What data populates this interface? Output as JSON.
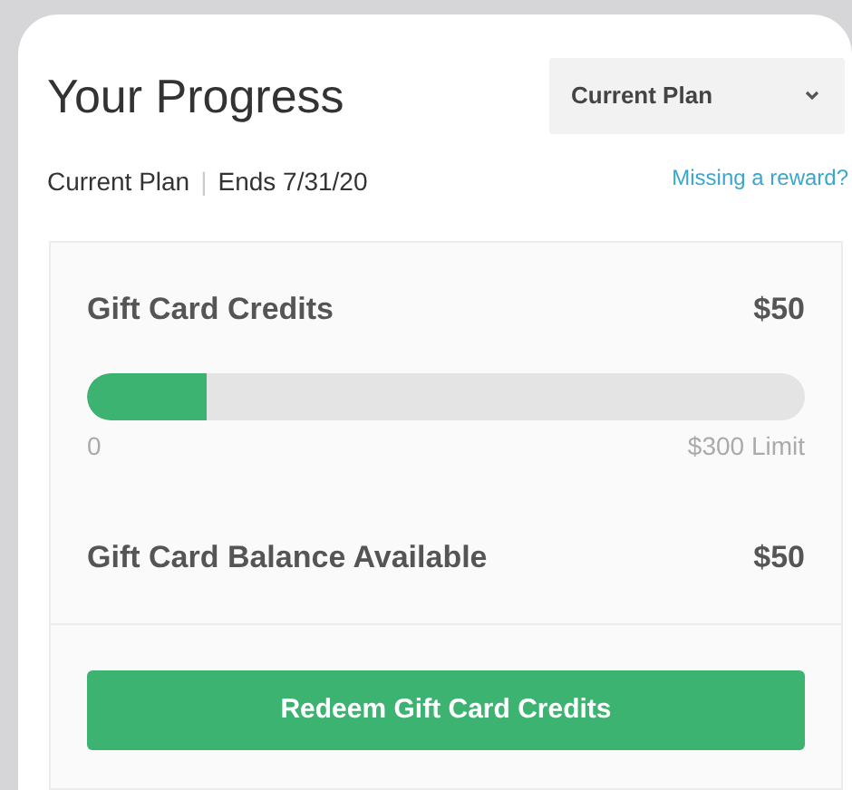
{
  "header": {
    "title": "Your Progress",
    "plan_select": {
      "value": "Current Plan"
    }
  },
  "plan_info": {
    "plan": "Current Plan",
    "separator": "|",
    "ends": "Ends 7/31/20",
    "link": "Missing a reward?"
  },
  "credits": {
    "label": "Gift Card Credits",
    "amount": "$50",
    "progress": {
      "level": 0.166,
      "min_label": "0",
      "max_label": "$300 Limit"
    }
  },
  "balance": {
    "label": "Gift Card Balance Available",
    "amount": "$50"
  },
  "redeem_button": "Redeem Gift Card Credits"
}
